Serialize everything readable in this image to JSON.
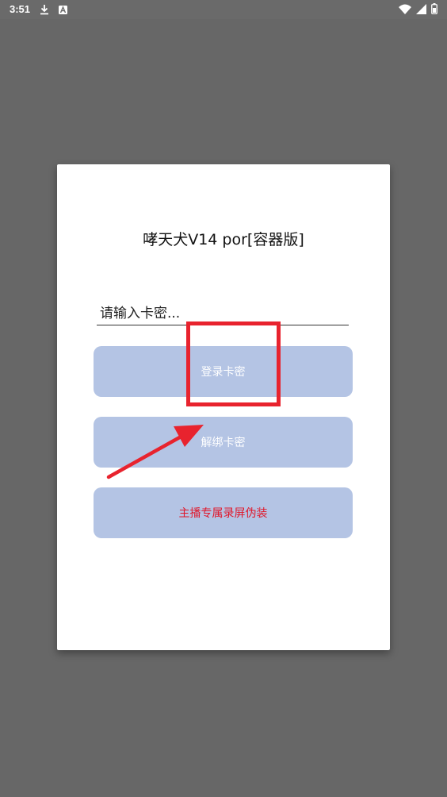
{
  "status_bar": {
    "time": "3:51",
    "left_icons": [
      "download-icon",
      "a-badge-icon"
    ],
    "right_icons": [
      "wifi-icon",
      "signal-icon",
      "battery-icon"
    ]
  },
  "dialog": {
    "title": "哮天犬V14 por[容器版]",
    "card_input": {
      "placeholder": "请输入卡密...",
      "value": ""
    },
    "buttons": {
      "login": "登录卡密",
      "unbind": "解绑卡密",
      "disguise": "主播专属录屏伪装"
    }
  },
  "annotations": {
    "highlight_color": "#e8232e",
    "arrow_color": "#e8232e"
  },
  "colors": {
    "button_bg": "#b4c4e4",
    "button_text": "#ffffff",
    "disguise_text": "#e0182b",
    "backdrop": "#676767"
  }
}
